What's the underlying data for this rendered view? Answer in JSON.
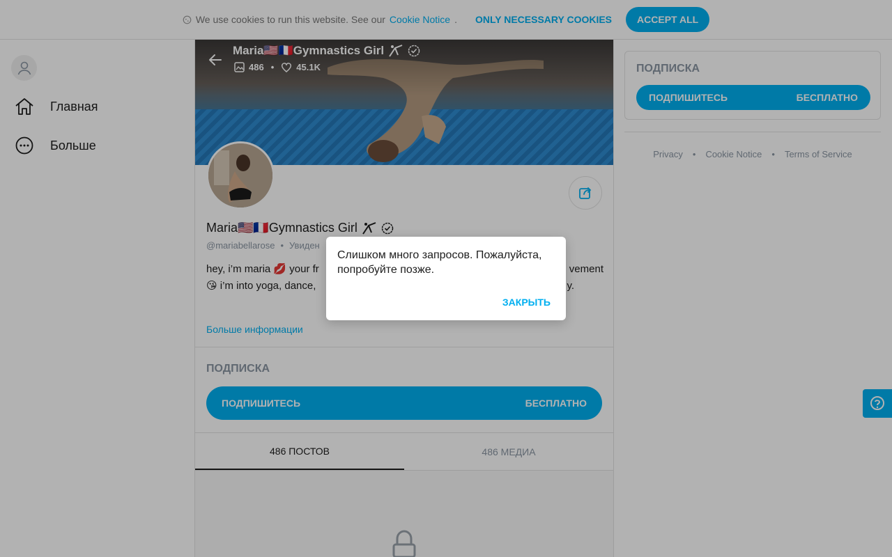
{
  "cookie_bar": {
    "text": "We use cookies to run this website. See our",
    "link": "Cookie Notice",
    "link_suffix": ".",
    "necessary_label": "ONLY NECESSARY COOKIES",
    "accept_label": "ACCEPT ALL"
  },
  "nav": {
    "home_label": "Главная",
    "more_label": "Больше"
  },
  "profile": {
    "name": "Maria🇺🇸🇫🇷Gymnastics Girl",
    "cover_name": "Maria🇺🇸🇫🇷Gymnastics Girl",
    "media_count": "486",
    "likes_count": "45.1K",
    "handle": "@mariabellarose",
    "last_seen": "Увиден",
    "bio_line1": "hey, i’m maria 💋 your fr",
    "bio_line1_end": "vement",
    "bio_line2": "😘 i’m into yoga, dance,",
    "bio_line2_end": "y.",
    "more_info": "Больше информации"
  },
  "subscription": {
    "title": "ПОДПИСКА",
    "subscribe_label": "ПОДПИШИТЕСЬ",
    "price_label": "БЕСПЛАТНО"
  },
  "tabs": {
    "posts": "486 ПОСТОВ",
    "media": "486 МЕДИА"
  },
  "right": {
    "title": "ПОДПИСКА",
    "subscribe_label": "ПОДПИШИТЕСЬ",
    "price_label": "БЕСПЛАТНО",
    "footer": [
      "Privacy",
      "•",
      "Cookie Notice",
      "•",
      "Terms of Service"
    ]
  },
  "modal": {
    "message": "Слишком много запросов. Пожалуйста, попробуйте позже.",
    "close_label": "ЗАКРЫТЬ"
  },
  "colors": {
    "accent": "#00aff0",
    "muted": "#8a96a3"
  }
}
